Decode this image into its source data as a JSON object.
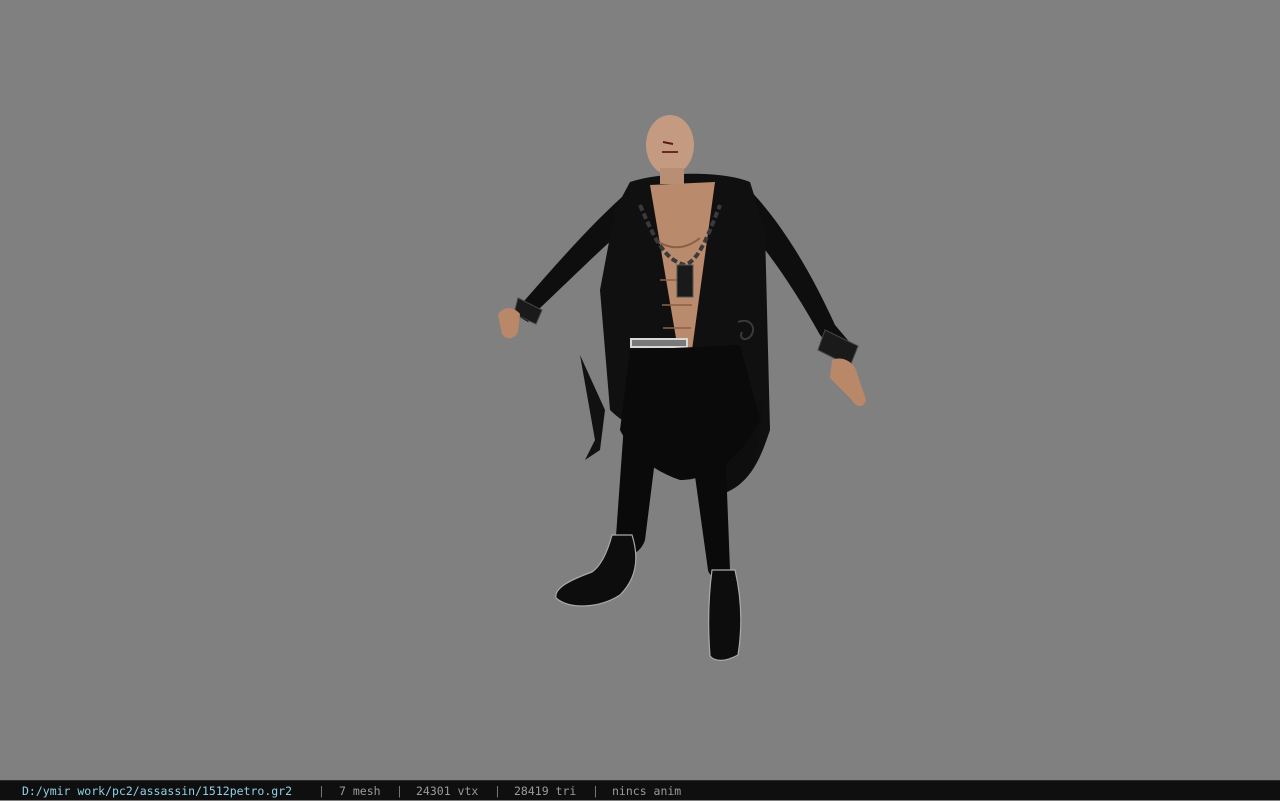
{
  "viewer": {
    "background_color": "#808080",
    "model_name": "assassin character model"
  },
  "status_bar": {
    "file_path": "D:/ymir work/pc2/assassin/1512petro.gr2",
    "separator": "|",
    "mesh_count": "7 mesh",
    "vertex_count": "24301 vtx",
    "triangle_count": "28419 tri",
    "animation_status": "nincs anim",
    "path_color": "#8fd0e8",
    "text_color": "#9a9a9a"
  }
}
